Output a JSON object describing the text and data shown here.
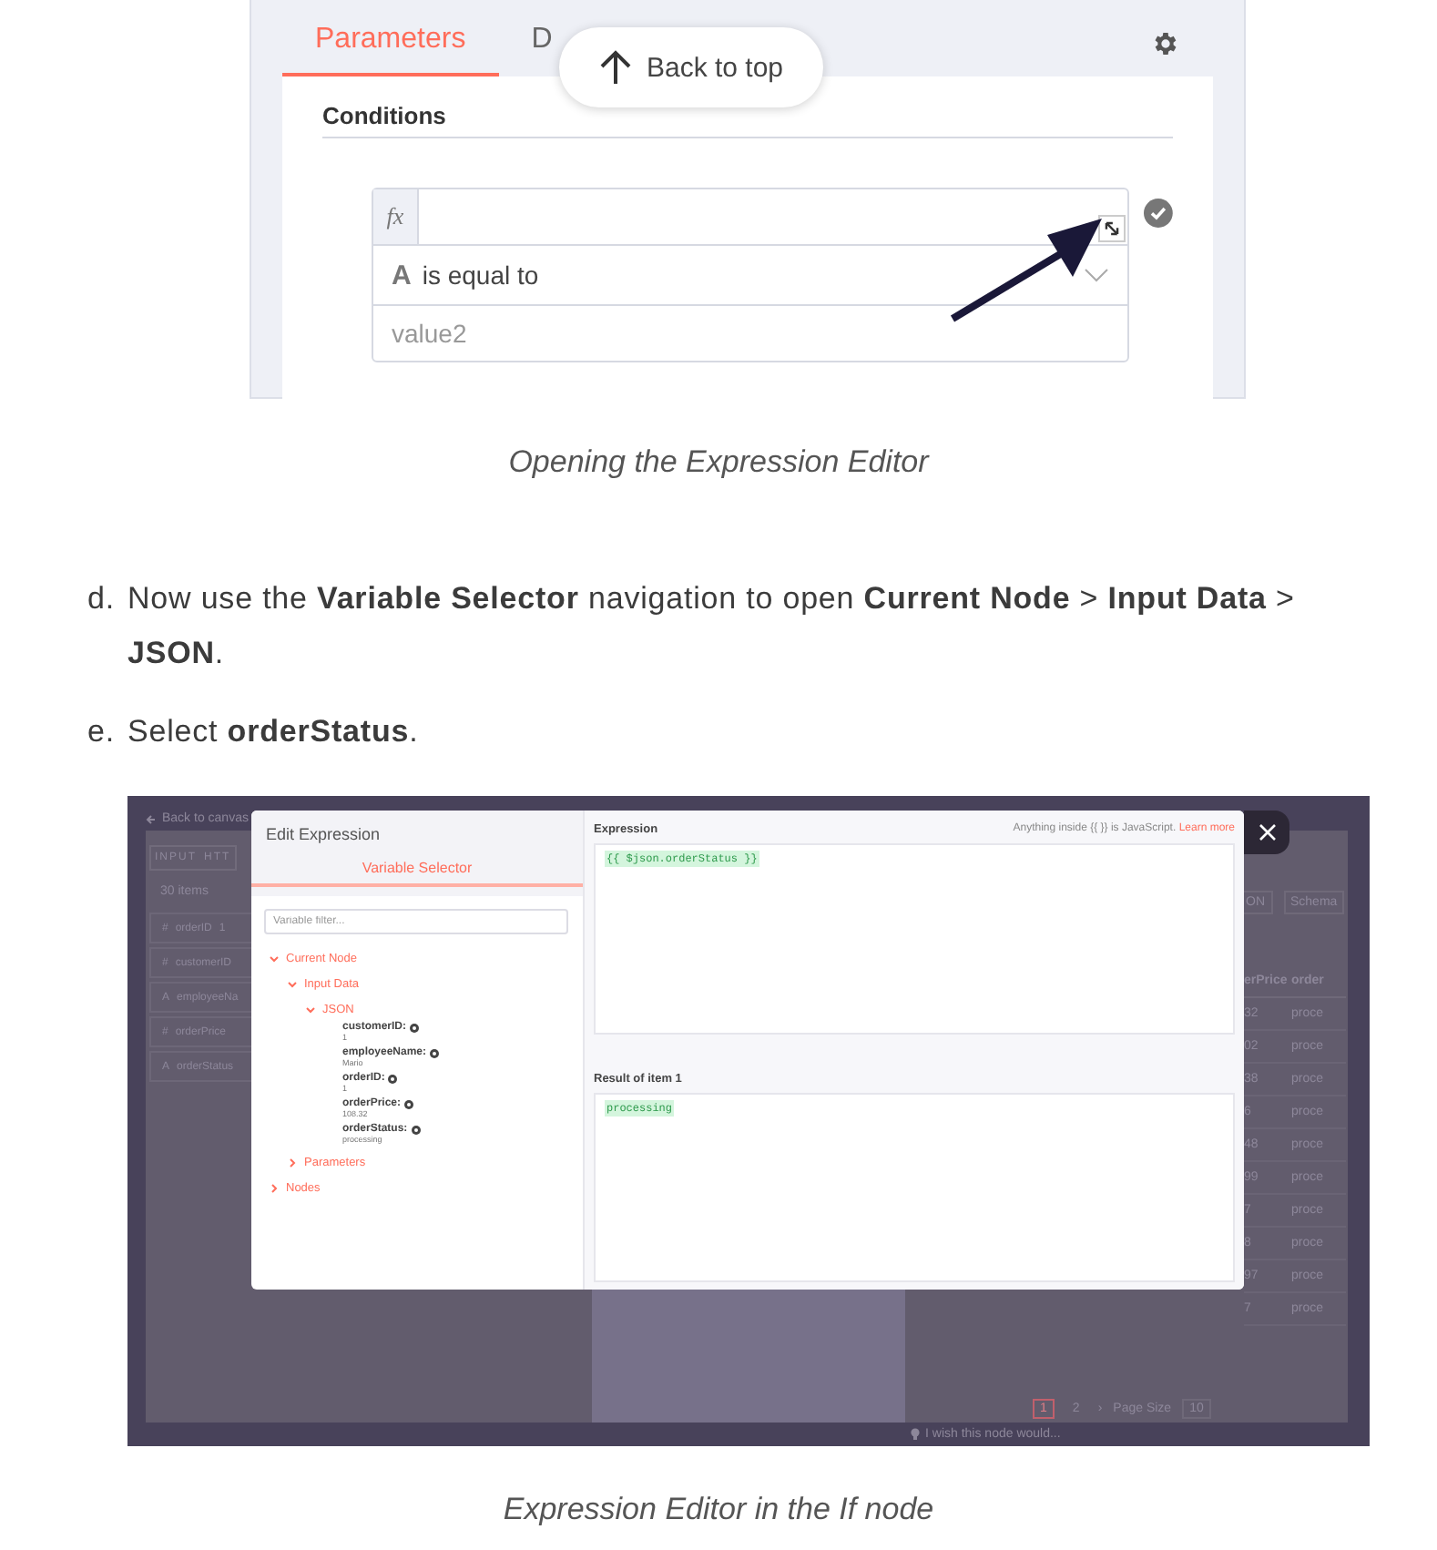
{
  "figure_1": {
    "tabs": [
      {
        "label": "Parameters",
        "selected": true
      },
      {
        "label": "D",
        "selected": false
      }
    ],
    "back_to_top": "Back to top",
    "section_title": "Conditions",
    "fx_label": "fx",
    "type_letter": "A",
    "operator": "is equal to",
    "value_placeholder": "value2"
  },
  "caption_1": "Opening the Expression Editor",
  "steps": [
    {
      "marker": "d.",
      "text": "Now use the **Variable Selector** navigation to open **Current Node** > **Input Data** > **JSON**."
    },
    {
      "marker": "e.",
      "text": "Select **orderStatus**."
    }
  ],
  "figure_2": {
    "background": {
      "back_link": "Back to canvas",
      "input_tabs": [
        "INPUT",
        "HTT"
      ],
      "item_count": "30 items",
      "fields": [
        {
          "type": "#",
          "name": "orderID",
          "extra": "1"
        },
        {
          "type": "#",
          "name": "customerID"
        },
        {
          "type": "A",
          "name": "employeeNa"
        },
        {
          "type": "#",
          "name": "orderPrice"
        },
        {
          "type": "A",
          "name": "orderStatus"
        }
      ],
      "output_tabs": [
        "ON",
        "Schema"
      ],
      "table": {
        "columns": [
          "erPrice",
          "order"
        ],
        "rows": [
          [
            "32",
            "proce"
          ],
          [
            "02",
            "proce"
          ],
          [
            "38",
            "proce"
          ],
          [
            "6",
            "proce"
          ],
          [
            "48",
            "proce"
          ],
          [
            "99",
            "proce"
          ],
          [
            "7",
            "proce"
          ],
          [
            "8",
            "proce"
          ],
          [
            "97",
            "proce"
          ],
          [
            "7",
            "proce"
          ]
        ]
      },
      "pagination": {
        "pages": [
          {
            "label": "1",
            "selected": true
          },
          {
            "label": "2",
            "selected": false
          }
        ],
        "next": "›",
        "page_size_label": "Page Size",
        "page_size": "10"
      },
      "feedback": "I wish this node would..."
    },
    "modal": {
      "title": "Edit Expression",
      "tabs": [
        {
          "label": "Variable Selector",
          "selected": true
        }
      ],
      "filter_placeholder": "Variable filter...",
      "tree": [
        {
          "kind": "group",
          "label": "Current Node",
          "expanded": true,
          "children": [
            {
              "kind": "group",
              "label": "Input Data",
              "expanded": true,
              "children": [
                {
                  "kind": "group",
                  "label": "JSON",
                  "expanded": true,
                  "children": [
                    {
                      "kind": "field",
                      "name": "customerID:",
                      "value": "1"
                    },
                    {
                      "kind": "field",
                      "name": "employeeName:",
                      "value": "Mario"
                    },
                    {
                      "kind": "field",
                      "name": "orderID:",
                      "value": "1"
                    },
                    {
                      "kind": "field",
                      "name": "orderPrice:",
                      "value": "108.32"
                    },
                    {
                      "kind": "field",
                      "name": "orderStatus:",
                      "value": "processing"
                    }
                  ]
                }
              ]
            },
            {
              "kind": "group",
              "label": "Parameters",
              "expanded": false
            }
          ]
        },
        {
          "kind": "group",
          "label": "Nodes",
          "expanded": false
        }
      ],
      "expression_label": "Expression",
      "hint": "Anything inside {{ }} is JavaScript.",
      "hint_link": "Learn more",
      "expression": "{{ $json.orderStatus }}",
      "result_label": "Result of item 1",
      "result": "processing"
    }
  },
  "caption_2": "Expression Editor in the If node"
}
